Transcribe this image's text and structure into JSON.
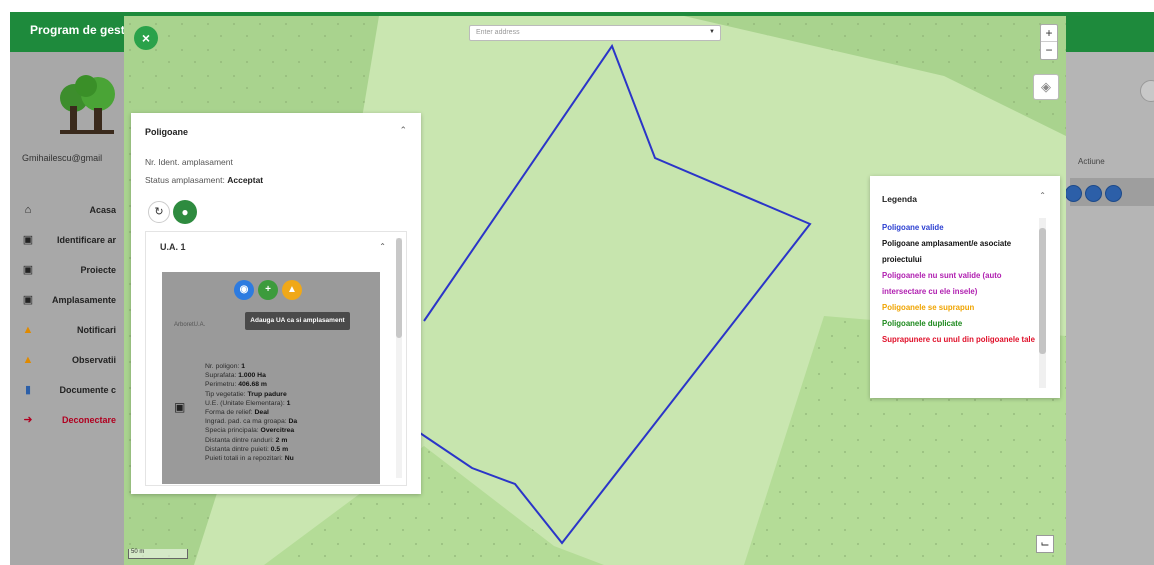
{
  "app": {
    "title": "Program de gest"
  },
  "user": {
    "email": "Gmihailescu@gmail"
  },
  "nav": {
    "items": [
      {
        "label": "Acasa",
        "icon": "home-icon"
      },
      {
        "label": "Identificare ar",
        "icon": "frame-icon"
      },
      {
        "label": "Proiecte",
        "icon": "frame-icon"
      },
      {
        "label": "Amplasamente",
        "icon": "frame-icon"
      },
      {
        "label": "Notificari",
        "icon": "warning-icon"
      },
      {
        "label": "Observatii",
        "icon": "warning-icon"
      },
      {
        "label": "Documente c",
        "icon": "document-icon"
      },
      {
        "label": "Deconectare",
        "icon": "logout-icon"
      }
    ]
  },
  "table": {
    "actions_header": "Actiune"
  },
  "map": {
    "address_placeholder": "Enter address",
    "zoom_in": "+",
    "zoom_out": "−",
    "scale_label": "50 m"
  },
  "panel": {
    "title": "Poligoane",
    "line1": "Nr. Ident. amplasament",
    "status_label": "Status amplasament:",
    "status_value": "Acceptat",
    "ua": {
      "title": "U.A. 1",
      "card_label": "ArboretU.A.",
      "tooltip": "Adauga UA ca si amplasament",
      "properties": [
        {
          "label": "Nr. poligon:",
          "value": "1"
        },
        {
          "label": "Suprafata:",
          "value": "1.000 Ha"
        },
        {
          "label": "Perimetru:",
          "value": "406.68 m"
        },
        {
          "label": "Tip vegetatie:",
          "value": "Trup padure"
        },
        {
          "label": "U.E. (Unitate Elementara):",
          "value": "1"
        },
        {
          "label": "Forma de relief:",
          "value": "Deal"
        },
        {
          "label": "Ingrad. pad. ca ma groapa:",
          "value": "Da"
        },
        {
          "label": "Specia principala:",
          "value": "Overcitrea"
        },
        {
          "label": "Distanta dintre randuri:",
          "value": "2 m"
        },
        {
          "label": "Distanta dintre puieti:",
          "value": "0.5 m"
        },
        {
          "label": "Puieti totali in a repozitari:",
          "value": "Nu"
        }
      ]
    }
  },
  "legend": {
    "title": "Legenda",
    "items": [
      {
        "text": "Poligoane valide",
        "color": "#2b3fd1"
      },
      {
        "text": "Poligoane amplasament/e asociate proiectului",
        "color": "#111111"
      },
      {
        "text": "Poligoanele nu sunt valide (auto intersectare cu ele insele)",
        "color": "#b01fb0"
      },
      {
        "text": "Poligoanele se suprapun",
        "color": "#f0a400"
      },
      {
        "text": "Poligoanele duplicate",
        "color": "#1e8a1e"
      },
      {
        "text": "Suprapunere cu unul din poligoanele tale",
        "color": "#e0102a"
      }
    ]
  },
  "colors": {
    "brand_green": "#1e8a3c",
    "polygon_stroke": "#2b35c8",
    "map_fill": "#c6e4ad"
  }
}
